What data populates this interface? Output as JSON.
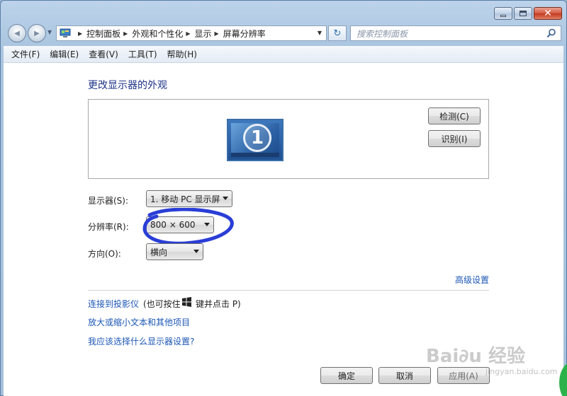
{
  "window": {
    "colors": {
      "accent_link": "#1c57b5",
      "title_blue": "#1e3287",
      "annotation": "#2a3ed6",
      "status_green": "#2bb24a"
    }
  },
  "caption": {
    "min_icon": "minimize-icon",
    "max_icon": "maximize-icon",
    "close_icon": "close-icon",
    "close_glyph": "✕"
  },
  "nav": {
    "back_glyph": "◀",
    "fwd_glyph": "▶",
    "drop_glyph": "▼"
  },
  "address": {
    "crumbs": [
      "控制面板",
      "外观和个性化",
      "显示",
      "屏幕分辨率"
    ],
    "separator": "▶",
    "drop_glyph": "▼"
  },
  "refresh": {
    "glyph": "↻"
  },
  "search": {
    "placeholder": "搜索控制面板"
  },
  "menu": {
    "items": [
      "文件(F)",
      "编辑(E)",
      "查看(V)",
      "工具(T)",
      "帮助(H)"
    ]
  },
  "main": {
    "title": "更改显示器的外观",
    "monitor_number": "1",
    "detect_label": "检测(C)",
    "identify_label": "识别(I)",
    "display_label": "显示器(S):",
    "display_value": "1. 移动 PC 显示屏",
    "resolution_label": "分辨率(R):",
    "resolution_value": "800 × 600",
    "orientation_label": "方向(O):",
    "orientation_value": "横向",
    "advanced_link": "高级设置",
    "projector_link": "连接到投影仪",
    "projector_note_pre": "(也可按住",
    "projector_note_post": "键并点击 P)",
    "text_size_link": "放大或缩小文本和其他项目",
    "which_settings_link": "我应该选择什么显示器设置?"
  },
  "footer": {
    "ok_label": "确定",
    "cancel_label": "取消",
    "apply_label": "应用(A)"
  },
  "watermark": {
    "text": "Bai∂u 经验",
    "sub": "jingyan.baidu.com"
  }
}
